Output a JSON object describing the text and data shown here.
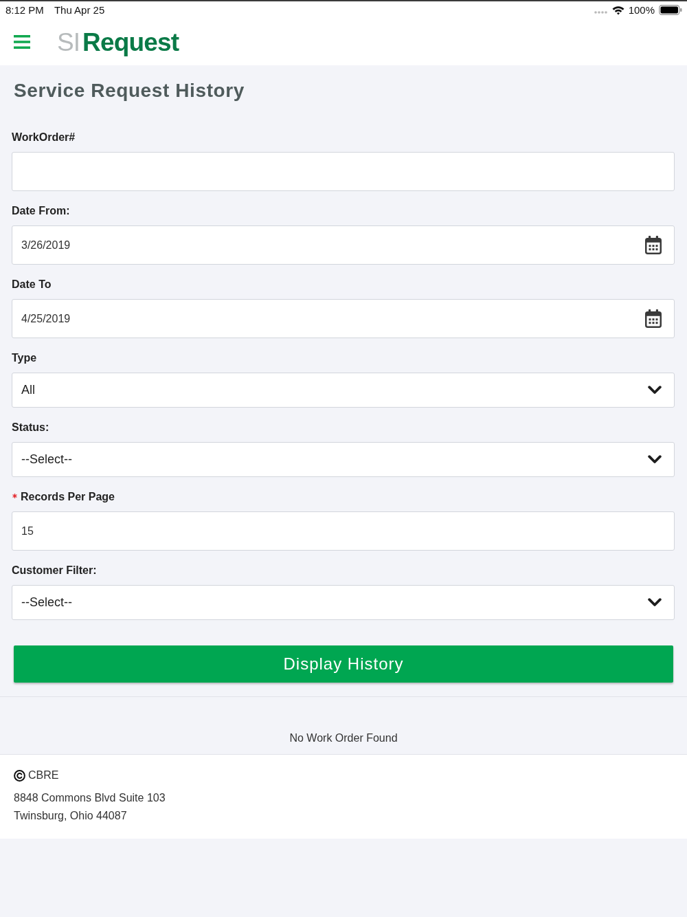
{
  "status_bar": {
    "time": "8:12 PM",
    "date": "Thu Apr 25",
    "battery": "100%"
  },
  "header": {
    "logo_prefix": "SI",
    "logo_name": "Request"
  },
  "page": {
    "title": "Service Request History"
  },
  "form": {
    "fields": [
      {
        "kind": "text",
        "label": "WorkOrder#",
        "required": false
      },
      {
        "kind": "date",
        "label": "Date From:",
        "value": "3/26/2019",
        "required": false
      },
      {
        "kind": "date",
        "label": "Date To",
        "value": "4/25/2019",
        "required": false
      },
      {
        "kind": "select",
        "label": "Type",
        "value": "All",
        "required": false
      },
      {
        "kind": "select",
        "label": "Status:",
        "value": "--Select--",
        "required": false
      },
      {
        "kind": "text",
        "label": "Records Per Page",
        "value": "15",
        "required": true
      },
      {
        "kind": "select",
        "label": "Customer Filter:",
        "value": "--Select--",
        "required": false
      }
    ],
    "submit": {
      "label": "Display History"
    }
  },
  "results": {
    "message": "No Work Order Found"
  },
  "footer": {
    "copyright": "CBRE",
    "address": [
      "8848 Commons Blvd Suite 103",
      "Twinsburg, Ohio 44087"
    ]
  }
}
